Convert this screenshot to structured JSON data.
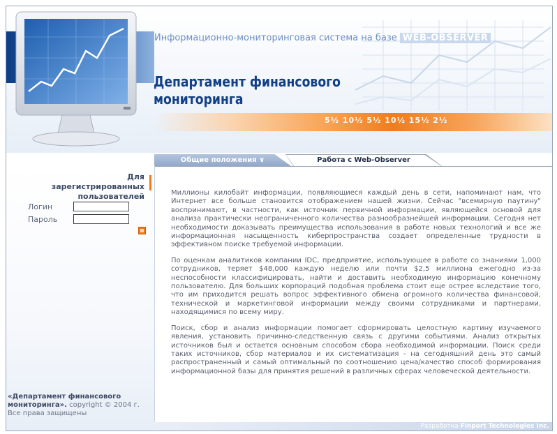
{
  "header": {
    "subtitle": "Информационно-мониторинговая система на базе",
    "subtitle_highlight": "WEB-OBSERVER",
    "title": "Департамент финансового мониторинга",
    "ticker": "5½ 10½ 5½ 10½ 15½ 2½"
  },
  "sidebar": {
    "login_heading": "Для зарегистрированных пользователей",
    "login_label": "Логин",
    "login_value": "",
    "password_label": "Пароль",
    "password_value": "",
    "footer_bold": "«Департамент финансового мониторинга».",
    "footer_text": " copyright © 2004 г. Все права защищены"
  },
  "tabs": [
    {
      "label": "Общие положения ∨",
      "active": true
    },
    {
      "label": "Работа с Web-Observer",
      "active": false
    }
  ],
  "content": {
    "paragraphs": [
      "Миллионы килобайт информации, появляющиеся каждый день в сети, напоминают нам, что Интернет все больше становится отображением нашей жизни. Сейчас \"всемирную паутину\" воспринимают, в частности, как источник первичной информации, являющейся основой для анализа практически неограниченного количества разнообразнейшей информации. Сегодня нет необходимости доказывать преимущества использования в работе новых технологий и все же информационная насыщенность киберпространства создает определенные трудности в эффективном поиске требуемой информации.",
      "По оценкам аналитиков компании IDC, предприятие, использующее в работе со знаниями 1,000 сотрудников, теряет $48,000 каждую неделю или почти $2,5 миллиона ежегодно из-за неспособности классифицировать, найти и доставить необходимую информацию конечному пользователю. Для больших корпораций подобная проблема стоит еще острее вследствие того, что им приходится решать вопрос эффективного обмена огромного количества финансовой, технической и маркетинговой информации между своими сотрудниками и партнерами, находящимися по всему миру.",
      "Поиск, сбор и анализ информации помогает сформировать целостную картину изучаемого явления, установить причинно-следственную связь с другими событиями. Анализ открытых источников был и остается основным способом сбора необходимой информации. Поиск среди таких источников, сбор материалов и их систематизация - на сегодняшний день это самый распространенный и самый оптимальный по соотношению цена/качество способ формирования информационной базы для принятия решений в различных сферах человеческой деятельности."
    ]
  },
  "bottom_bar": {
    "prefix": "Разработка",
    "company": "Finport Technologies Inc."
  },
  "colors": {
    "title_blue": "#123f86",
    "accent_orange": "#f07a1a"
  }
}
